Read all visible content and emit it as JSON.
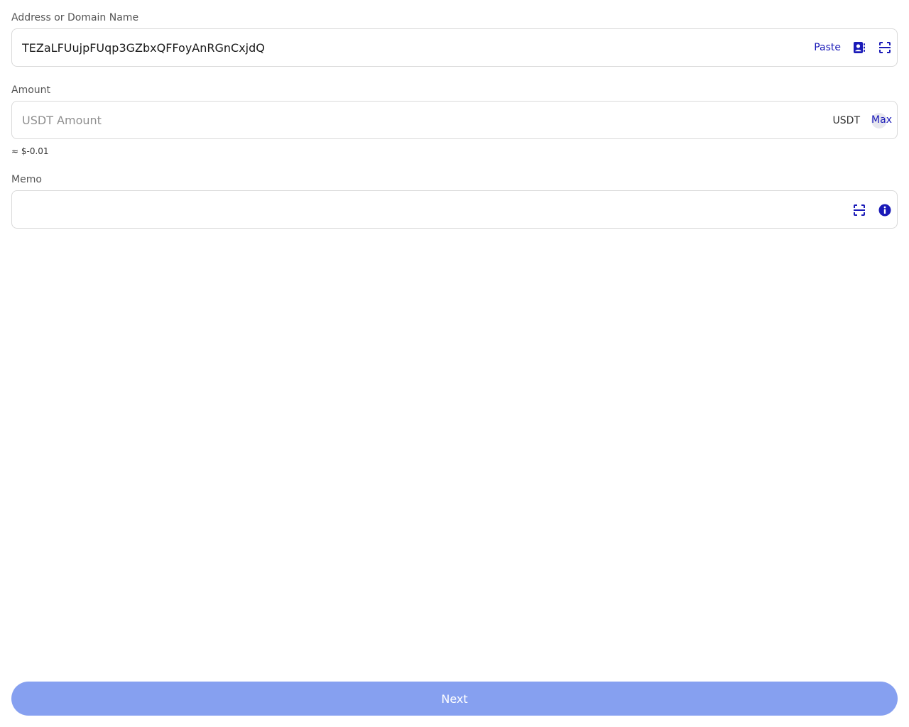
{
  "address": {
    "label": "Address or Domain Name",
    "value": "TEZaLFUujpFUqp3GZbxQFFoyAnRGnCxjdQ",
    "paste_label": "Paste",
    "contacts_icon": "contact-book-icon",
    "scan_icon": "qr-scan-icon"
  },
  "amount": {
    "label": "Amount",
    "placeholder": "USDT Amount",
    "unit": "USDT",
    "max_label": "Max",
    "usd_estimate": "≈ $-0.01"
  },
  "memo": {
    "label": "Memo",
    "value": "",
    "scan_icon": "qr-scan-icon",
    "info_icon": "info-icon"
  },
  "footer": {
    "next_label": "Next"
  },
  "colors": {
    "accent": "#1a1ab8",
    "button_disabled": "#86a0f0",
    "border": "#d9d9d9"
  }
}
